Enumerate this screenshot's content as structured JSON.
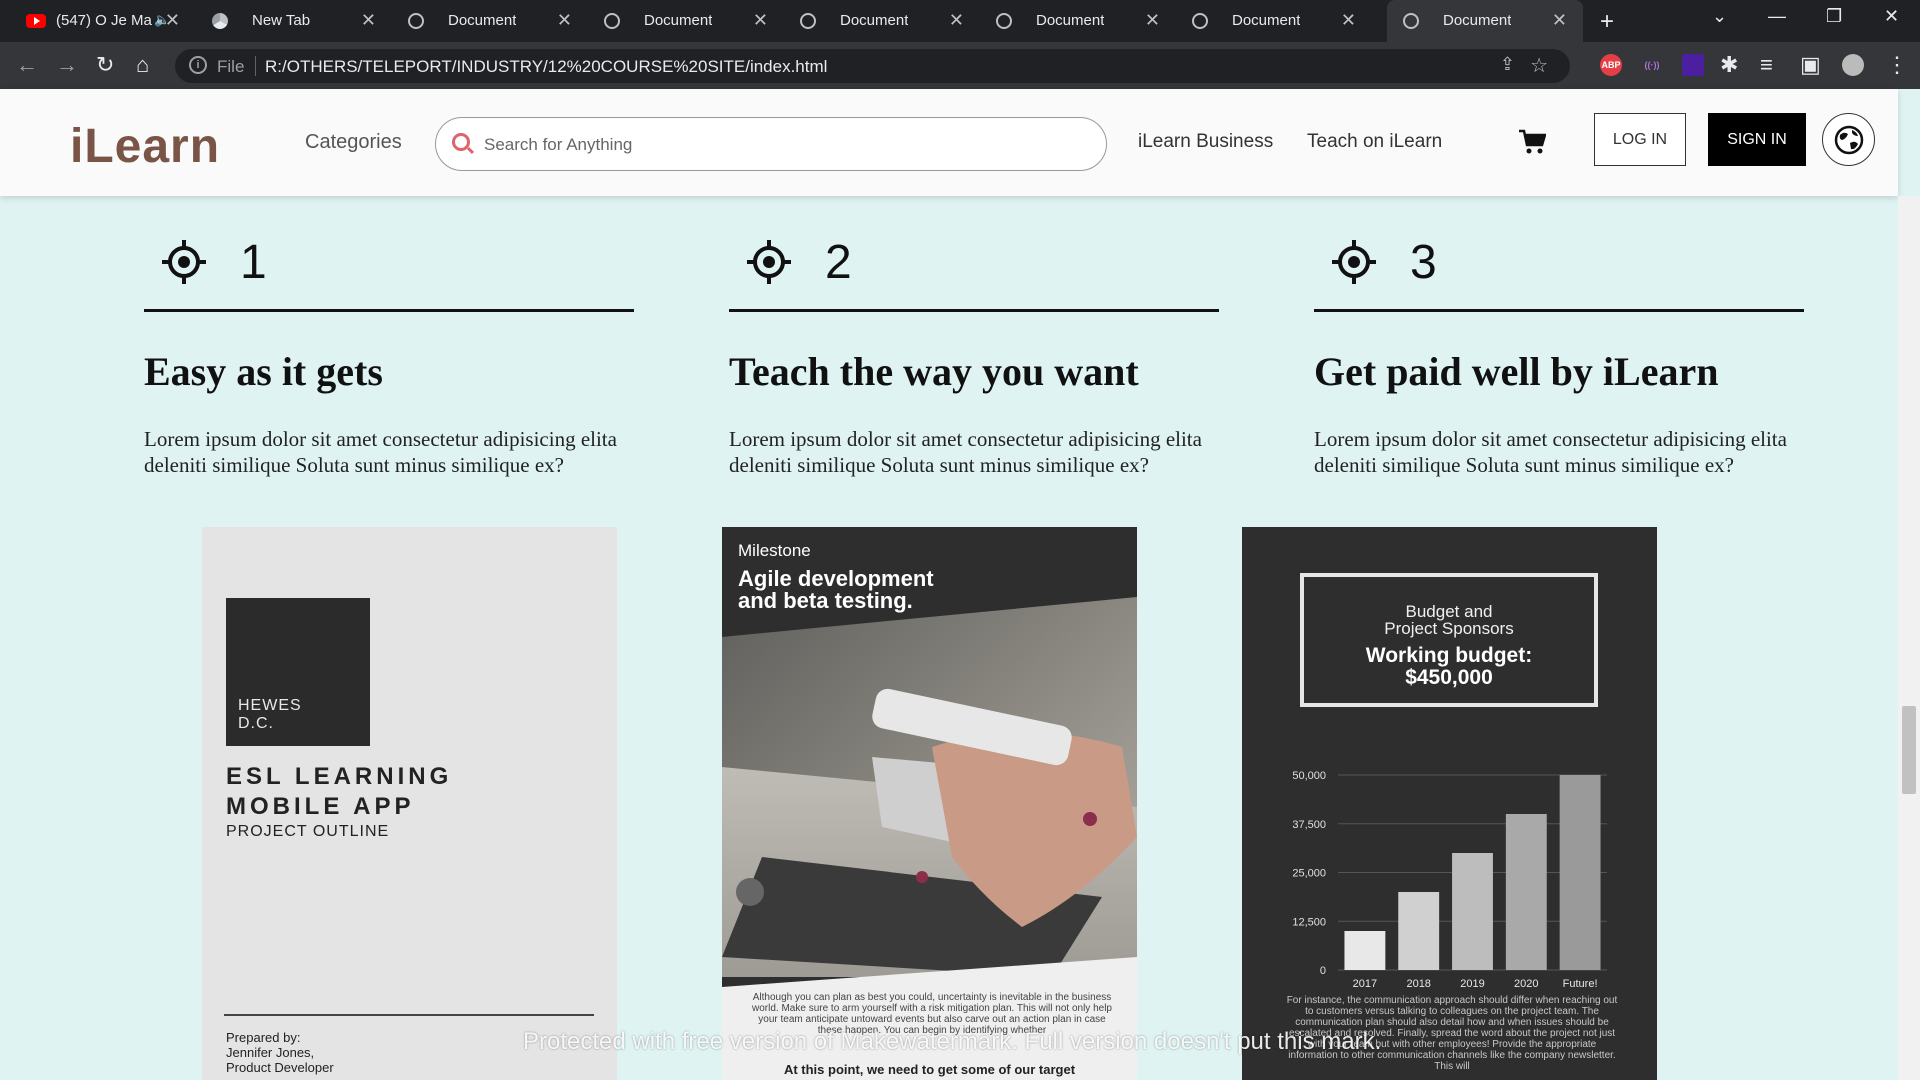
{
  "browser": {
    "tabs": [
      {
        "title": "(547) O Je Ma",
        "favicon": "youtube-icon",
        "muted": true,
        "active": false
      },
      {
        "title": "New Tab",
        "favicon": "chrome-icon",
        "active": false
      },
      {
        "title": "Document",
        "favicon": "globe-icon",
        "active": false
      },
      {
        "title": "Document",
        "favicon": "globe-icon",
        "active": false
      },
      {
        "title": "Document",
        "favicon": "globe-icon",
        "active": false
      },
      {
        "title": "Document",
        "favicon": "globe-icon",
        "active": false
      },
      {
        "title": "Document",
        "favicon": "globe-icon",
        "active": false
      },
      {
        "title": "Document",
        "favicon": "globe-icon",
        "active": true
      }
    ],
    "address": {
      "scheme_label": "File",
      "url": "R:/OTHERS/TELEPORT/INDUSTRY/12%20COURSE%20SITE/index.html"
    },
    "extensions": [
      {
        "name": "adblock-plus-icon",
        "label": "ABP",
        "color": "#e43f47"
      },
      {
        "name": "cast-icon",
        "label": "((·))",
        "color": "#7b2fb5"
      },
      {
        "name": "grid-extension-icon",
        "label": "",
        "color": "#4b1fa0"
      }
    ]
  },
  "site": {
    "logo": "iLearn",
    "categories": "Categories",
    "search_placeholder": "Search for Anything",
    "links": {
      "business": "iLearn Business",
      "teach": "Teach on iLearn"
    },
    "login": "LOG IN",
    "signin": "SIGN IN",
    "colors": {
      "brand": "#7a5446",
      "background": "#dff3f3",
      "search_icon": "#e0626a"
    }
  },
  "steps": [
    {
      "number": "1",
      "title": "Easy as it gets",
      "text": "Lorem ipsum dolor sit amet consectetur adipisicing elita deleniti similique Soluta sunt minus similique ex?"
    },
    {
      "number": "2",
      "title": "Teach the way you want",
      "text": "Lorem ipsum dolor sit amet consectetur adipisicing elita deleniti similique Soluta sunt minus similique ex?"
    },
    {
      "number": "3",
      "title": "Get paid well by iLearn",
      "text": "Lorem ipsum dolor sit amet consectetur adipisicing elita deleniti similique Soluta sunt minus similique ex?"
    }
  ],
  "cards": {
    "card1": {
      "block_text": "HEWES\nD.C.",
      "title_line1": "ESL LEARNING",
      "title_line2": "MOBILE APP",
      "subtitle": "PROJECT OUTLINE",
      "prepared_by": "Prepared by:",
      "person": "Jennifer Jones,",
      "role": "Product Developer"
    },
    "card2": {
      "label": "Milestone",
      "title_line1": "Agile development",
      "title_line2": "and beta testing.",
      "body": "Although you can plan as best you could, uncertainty is inevitable in the business world. Make sure to arm yourself with a risk mitigation plan. This will not only help your team anticipate untoward events but also carve out an action plan in case these happen. You can begin by identifying whether",
      "footer": "At this point, we need to get some of our target"
    },
    "card3": {
      "box_line1": "Budget and",
      "box_line2": "Project Sponsors",
      "budget_line1": "Working budget:",
      "budget_line2": "$450,000",
      "body": "For instance, the communication approach should differ when reaching out to customers versus talking to colleagues on the project team. The communication plan should also detail how and when issues should be escalated and resolved. Finally, spread the word about the project not just with your team but with other employees! Provide the appropriate information to other communication channels like the company newsletter. This will"
    }
  },
  "chart_data": {
    "type": "bar",
    "categories": [
      "2017",
      "2018",
      "2019",
      "2020",
      "Future!"
    ],
    "values": [
      10000,
      20000,
      30000,
      40000,
      50000
    ],
    "yticks": [
      "0",
      "12,500",
      "25,000",
      "37,500",
      "50,000"
    ],
    "ylim": [
      0,
      50000
    ],
    "grid": true,
    "bar_colors": [
      "#e8e8e8",
      "#d0d0d0",
      "#bdbdbd",
      "#a9a9a9",
      "#9a9a9a"
    ]
  },
  "watermark": "Protected with free version of Makewatermark. Full version doesn't put this mark."
}
